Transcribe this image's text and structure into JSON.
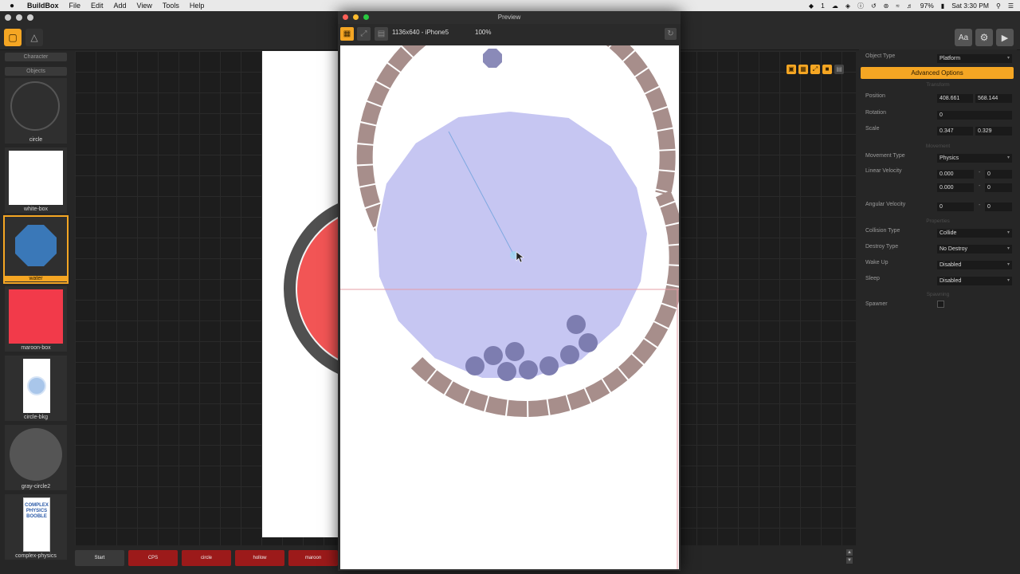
{
  "menubar": {
    "app_name": "BuildBox",
    "items": [
      "File",
      "Edit",
      "Add",
      "View",
      "Tools",
      "Help"
    ],
    "status": {
      "battery": "97%",
      "clock": "Sat 3:30 PM",
      "notif_count": "1"
    }
  },
  "sidebar": {
    "headers": [
      "Character",
      "Objects"
    ],
    "assets": [
      {
        "label": "circle"
      },
      {
        "label": "white-box"
      },
      {
        "label": "water",
        "selected": true
      },
      {
        "label": "maroon-box"
      },
      {
        "label": "circle-bkg"
      },
      {
        "label": "gray-circle2"
      },
      {
        "label": "complex-physics"
      }
    ],
    "book_text": "COMPLEX PHYSICS BOOBLE"
  },
  "preview": {
    "title": "Preview",
    "resolution": "1136x640 - iPhone5",
    "zoom": "100%"
  },
  "scenebar": {
    "buttons": [
      "Start",
      "CPS",
      "circle",
      "hollow",
      "maroon"
    ]
  },
  "props": {
    "object_type_label": "Object Type",
    "object_type_value": "Platform",
    "advanced_button": "Advanced Options",
    "section_transform": "Transform",
    "position_label": "Position",
    "position_x": "408.661",
    "position_y": "568.144",
    "rotation_label": "Rotation",
    "rotation_value": "0",
    "scale_label": "Scale",
    "scale_x": "0.347",
    "scale_y": "0.329",
    "section_movement": "Movement",
    "movement_type_label": "Movement Type",
    "movement_type_value": "Physics",
    "linear_velocity_label": "Linear Velocity",
    "lv1_a": "0.000",
    "lv1_b": "0",
    "lv2_a": "0.000",
    "lv2_b": "0",
    "angular_velocity_label": "Angular Velocity",
    "av_a": "0",
    "av_b": "0",
    "section_properties": "Properties",
    "collision_type_label": "Collision Type",
    "collision_type_value": "Collide",
    "destroy_type_label": "Destroy Type",
    "destroy_type_value": "No Destroy",
    "wake_up_label": "Wake Up",
    "wake_up_value": "Disabled",
    "sleep_label": "Sleep",
    "sleep_value": "Disabled",
    "section_spawning": "Spawning",
    "spawner_label": "Spawner",
    "dash": "-"
  },
  "colors": {
    "accent": "#f5a623",
    "water_fill": "#c6c6f2",
    "ring": "#a78e8b",
    "maroon": "#f23a4a",
    "scene_red": "#9c1a1a"
  }
}
